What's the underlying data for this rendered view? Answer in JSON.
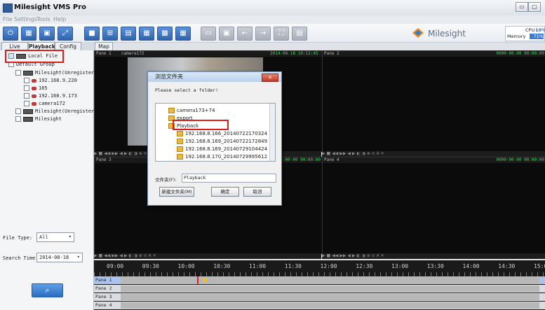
{
  "app": {
    "title": "Milesight VMS Pro"
  },
  "menu": [
    "File",
    "Settings",
    "Tools",
    "Help"
  ],
  "logo": {
    "text": "Milesight"
  },
  "meters": {
    "cpu_label": "CPU",
    "cpu_value": "10%",
    "memory_label": "Memory",
    "memory_value": "71%"
  },
  "tabs": [
    "Live",
    "Playback",
    "Config",
    "Map"
  ],
  "sidebar": {
    "local_file": "Local File",
    "default_group": "Default Group",
    "devices": [
      {
        "label": "Milesight(Unregistered)",
        "kind": "device",
        "indent": 1
      },
      {
        "label": "192.168.9.220",
        "kind": "camera",
        "indent": 2
      },
      {
        "label": "165",
        "kind": "camera",
        "indent": 2
      },
      {
        "label": "192.168.9.173",
        "kind": "camera",
        "indent": 2
      },
      {
        "label": "camera172",
        "kind": "camera",
        "indent": 2
      },
      {
        "label": "Milesight(Unregistered)",
        "kind": "device",
        "indent": 1
      },
      {
        "label": "Milesight",
        "kind": "device",
        "indent": 1
      }
    ],
    "file_type_label": "File Type:",
    "file_type_value": "All",
    "search_time_label": "Search Time:",
    "search_time_value": "2014-08-18"
  },
  "panes": {
    "p1": {
      "name": "Pane 1",
      "camera": "camera172",
      "time": "2014-08-18 10:12:45"
    },
    "p2": {
      "name": "Pane 2",
      "time": "0000-00-00 00:00:00"
    },
    "p3": {
      "name": "Pane 3",
      "time": "0000-00-00 00:00:00"
    },
    "p4": {
      "name": "Pane 4",
      "time": "0000-00-00 00:00:00"
    },
    "controls": "▶ ■ ◀◀ ▶▶ ◀ ▶ ◐ ◑ ⊕ ⊙ A ✕"
  },
  "timeline": {
    "hours": [
      "09:00",
      "09:30",
      "10:00",
      "10:30",
      "11:00",
      "11:30",
      "12:00",
      "12:30",
      "13:00",
      "13:30",
      "14:00",
      "14:30",
      "15:00"
    ],
    "rows": [
      "Pane 1",
      "Pane 2",
      "Pane 3",
      "Pane 4"
    ]
  },
  "dialog": {
    "title": "浏览文件夹",
    "prompt": "Please select a folder!",
    "folders": [
      {
        "label": "camera173+74",
        "level": 1
      },
      {
        "label": "export",
        "level": 1
      },
      {
        "label": "Playback",
        "level": 1
      },
      {
        "label": "192.168.8.166_20140722170324",
        "level": 2
      },
      {
        "label": "192.168.8.169_20140722172849",
        "level": 2
      },
      {
        "label": "192.168.8.169_20140729104424",
        "level": 2
      },
      {
        "label": "192.168.8.170_20140729995612",
        "level": 2
      }
    ],
    "folder_label": "文件夹(F):",
    "folder_value": "Playback",
    "new_folder": "新建文件夹(M)",
    "ok": "确定",
    "cancel": "取消"
  },
  "colors": {
    "accent": "#2f64ad",
    "highlight": "#d91c1c",
    "timeline_green": "#57d36a"
  }
}
